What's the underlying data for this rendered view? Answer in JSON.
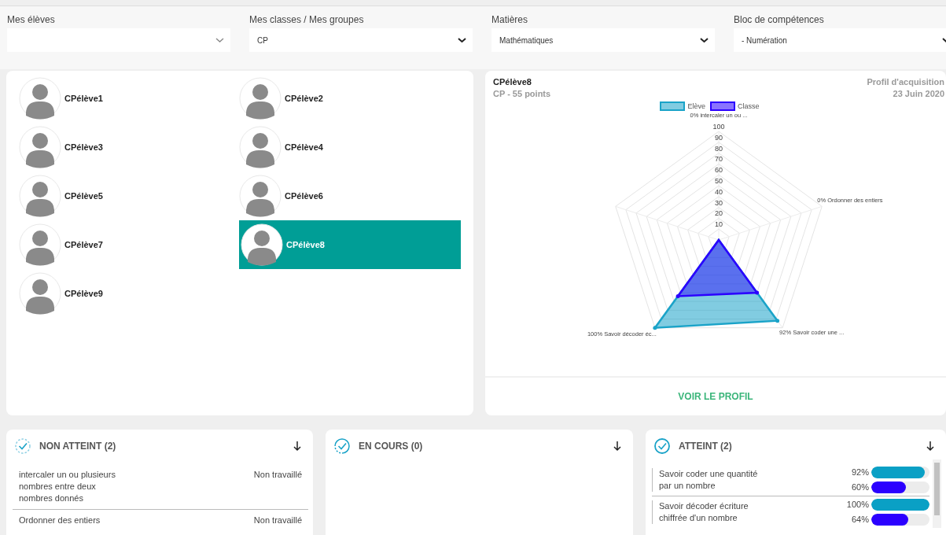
{
  "filters": [
    {
      "label": "Mes élèves"
    },
    {
      "label": "Mes classes / Mes groupes",
      "value": "CP"
    },
    {
      "label": "Matières",
      "value": "Mathématiques"
    },
    {
      "label": "Bloc de compétences",
      "value": "- Numération"
    }
  ],
  "students": [
    {
      "name": "CPélève1",
      "selected": false
    },
    {
      "name": "CPélève2",
      "selected": false
    },
    {
      "name": "CPélève3",
      "selected": false
    },
    {
      "name": "CPélève4",
      "selected": false
    },
    {
      "name": "CPélève5",
      "selected": false
    },
    {
      "name": "CPélève6",
      "selected": false
    },
    {
      "name": "CPélève7",
      "selected": false
    },
    {
      "name": "CPélève8",
      "selected": true
    },
    {
      "name": "CPélève9",
      "selected": false
    }
  ],
  "profile": {
    "name": "CPélève8",
    "subtitle": "CP - 55 points",
    "title": "Profil d'acquisition",
    "date": "23 Juin 2020",
    "button": "VOIR LE PROFIL",
    "radar": {
      "axes": [
        "0% intercaler un ou ...",
        "0% Ordonner des entiers",
        "92% Savoir coder une ...",
        "100% Savoir décoder éc..."
      ],
      "ticks": [
        "100",
        "90",
        "80",
        "70",
        "60",
        "50",
        "40",
        "30",
        "20",
        "10"
      ],
      "series": [
        {
          "name": "Elève",
          "color": "#1aa3c8"
        },
        {
          "name": "Classe",
          "color": "#2b00ff"
        }
      ]
    }
  },
  "status_columns": [
    {
      "kind": "non_atteint",
      "title": "NON ATTEINT (2)",
      "items": [
        {
          "text": "intercaler un ou plusieurs nombres entre deux nombres donnés",
          "status": "Non travaillé"
        },
        {
          "text": "Ordonner des entiers",
          "status": "Non travaillé"
        }
      ]
    },
    {
      "kind": "en_cours",
      "title": "EN COURS (0)"
    },
    {
      "kind": "atteint",
      "title": "ATTEINT (2)",
      "items": [
        {
          "text": "Savoir coder une quantité par un nombre",
          "bars": [
            {
              "reading": "92%",
              "level": 0.92,
              "color": "#0aa0c5"
            },
            {
              "reading": "60%",
              "level": 0.6,
              "color": "#2b00ff"
            }
          ]
        },
        {
          "text": "Savoir décoder écriture chiffrée d'un nombre",
          "bars": [
            {
              "reading": "100%",
              "level": 1,
              "color": "#0aa0c5"
            },
            {
              "reading": "64%",
              "level": 0.64,
              "color": "#2b00ff"
            }
          ]
        }
      ]
    }
  ]
}
